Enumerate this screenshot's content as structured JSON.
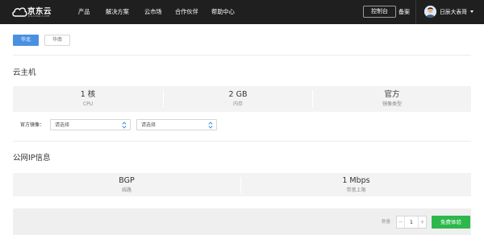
{
  "header": {
    "brand": "京东云",
    "brand_sub": "JCLOUD.COM",
    "nav": [
      "产品",
      "解决方案",
      "云市场",
      "合作伙伴",
      "帮助中心"
    ],
    "console_label": "控制台",
    "beian_label": "备案",
    "username": "日辰大表哥"
  },
  "regions": [
    "华北",
    "华南"
  ],
  "vm": {
    "title": "云主机",
    "specs": [
      {
        "value": "1 核",
        "label": "CPU"
      },
      {
        "value": "2 GB",
        "label": "内存"
      },
      {
        "value": "官方",
        "label": "镜像类型"
      }
    ],
    "image_label": "官方镜像：",
    "select1_value": "请选择",
    "select2_value": "请选择"
  },
  "ip": {
    "title": "公网IP信息",
    "specs": [
      {
        "value": "BGP",
        "label": "线路"
      },
      {
        "value": "1 Mbps",
        "label": "带宽上限"
      }
    ]
  },
  "footer": {
    "qty_label": "数量",
    "qty_value": "1",
    "minus": "−",
    "plus": "+",
    "button_label": "免费体验"
  },
  "colors": {
    "nav_bg": "#1f1f1f",
    "accent_blue": "#4a90e2",
    "accent_green": "#2db84a"
  }
}
